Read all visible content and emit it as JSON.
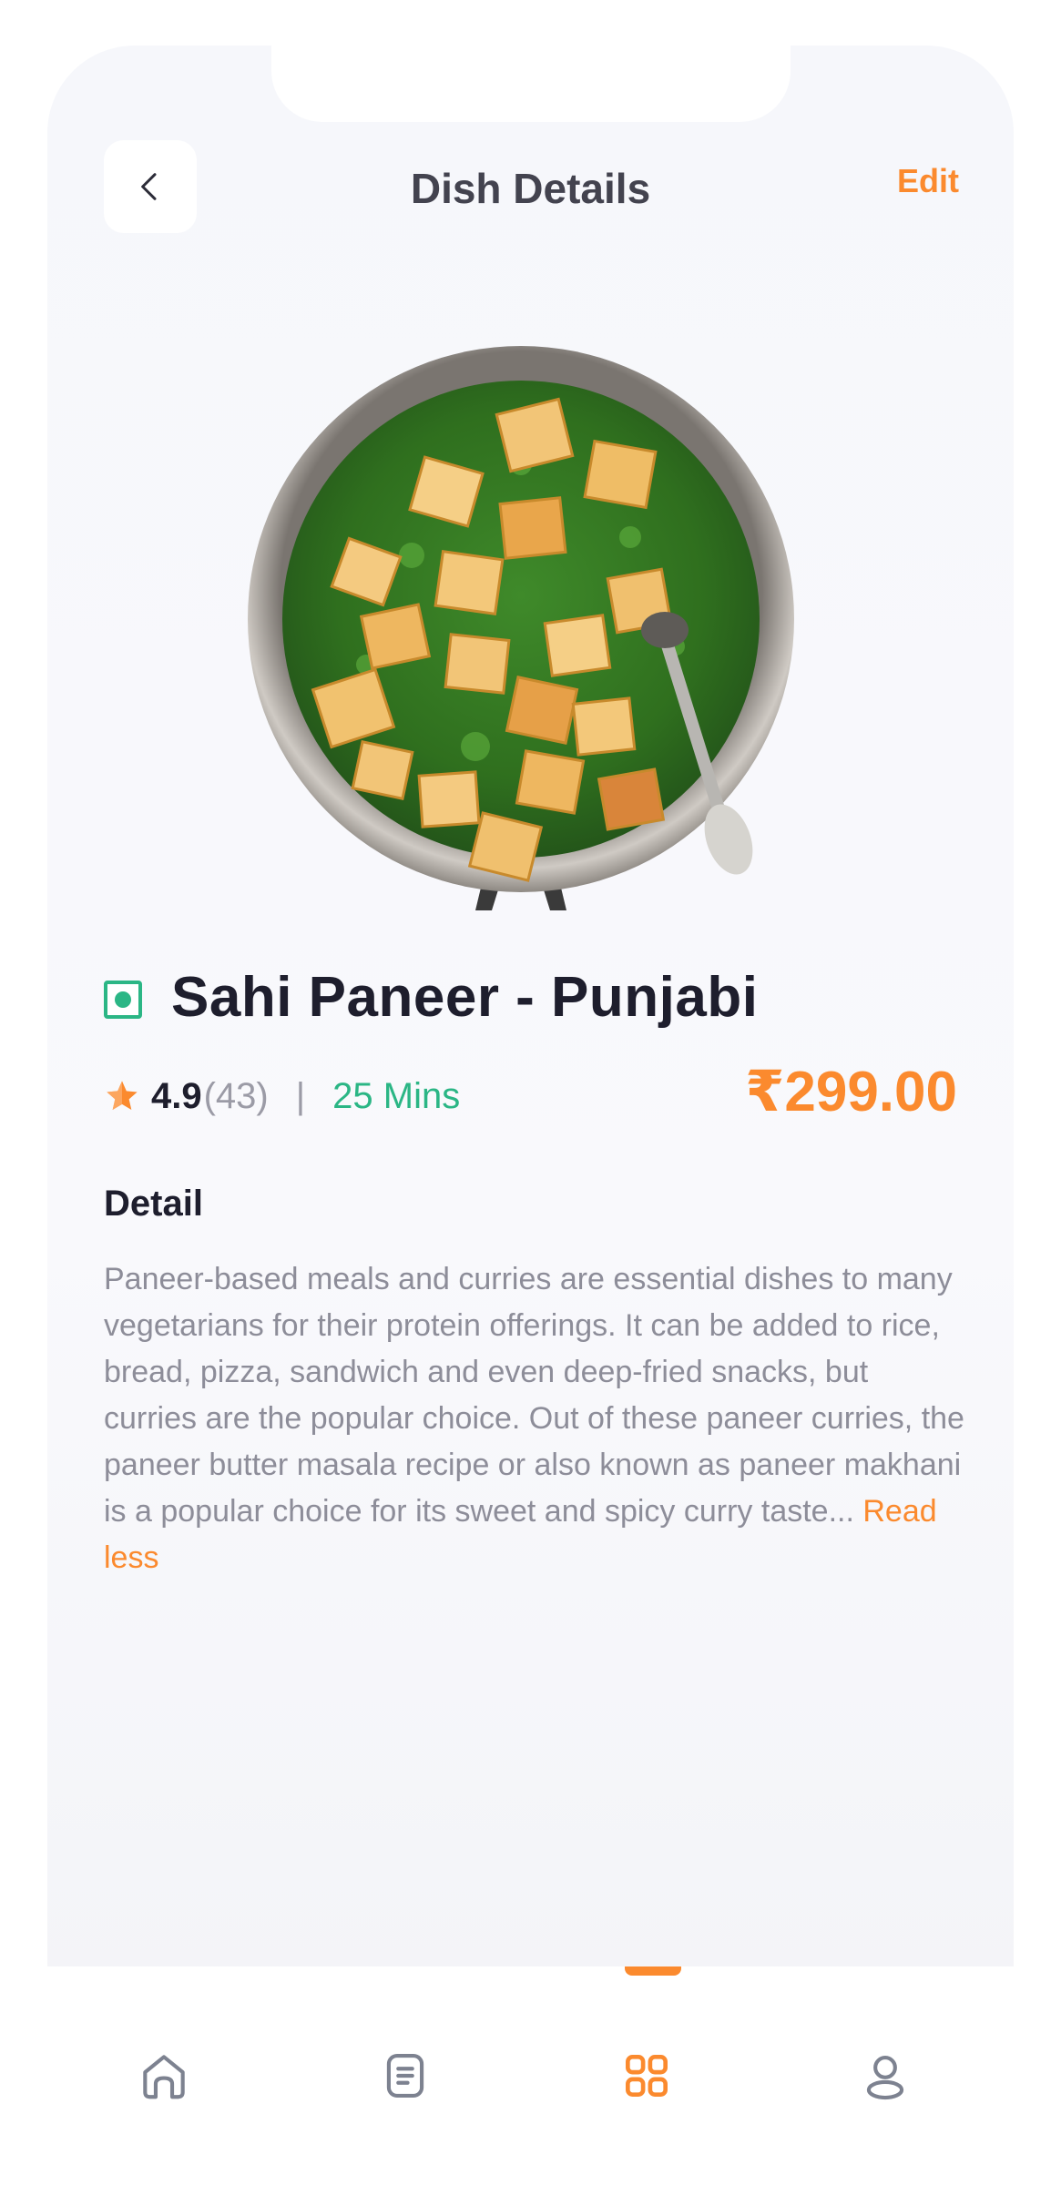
{
  "header": {
    "title": "Dish Details",
    "edit_label": "Edit"
  },
  "dish": {
    "image_icon": "saag-paneer-pan-image",
    "name": "Sahi Paneer - Punjabi",
    "rating": "4.9",
    "rating_count": "(43)",
    "separator": "|",
    "prep_time": "25 Mins",
    "price": "₹299.00",
    "detail_heading": "Detail",
    "description": "Paneer-based meals and curries are essential dishes to many vegetarians for their protein offerings. It can be added to rice, bread, pizza, sandwich and even deep-fried snacks, but curries are the popular choice. Out of these paneer curries, the paneer butter masala recipe or also known as paneer makhani is a popular choice for its sweet and spicy curry taste... ",
    "read_less_label": "Read less"
  },
  "tabbar": {
    "items": [
      {
        "icon": "home-icon",
        "active": false
      },
      {
        "icon": "orders-list-icon",
        "active": false
      },
      {
        "icon": "grid-menu-icon",
        "active": true
      },
      {
        "icon": "profile-icon",
        "active": false
      }
    ]
  },
  "colors": {
    "accent": "#fb8a2e",
    "veg_green": "#2bb685",
    "title_dark": "#1e1e2d",
    "muted_text": "#8d8d99"
  }
}
